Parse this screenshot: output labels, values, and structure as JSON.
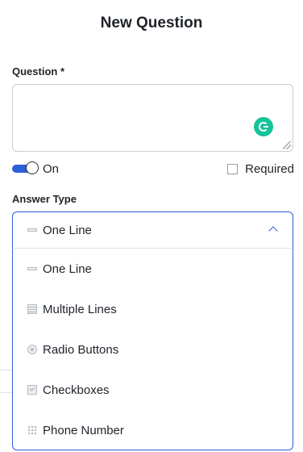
{
  "dialog": {
    "title": "New Question"
  },
  "question": {
    "label": "Question *",
    "value": ""
  },
  "toggle": {
    "label": "On",
    "state": true
  },
  "required": {
    "label": "Required",
    "checked": false
  },
  "answer_type": {
    "label": "Answer Type",
    "selected": "One Line",
    "options": [
      {
        "label": "One Line",
        "icon": "single-line-icon"
      },
      {
        "label": "Multiple Lines",
        "icon": "multiple-lines-icon"
      },
      {
        "label": "Radio Buttons",
        "icon": "radio-button-icon"
      },
      {
        "label": "Checkboxes",
        "icon": "checkbox-icon"
      },
      {
        "label": "Phone Number",
        "icon": "phone-keypad-icon"
      }
    ]
  },
  "colors": {
    "accent": "#2d5fd6",
    "grammarly": "#15c39a"
  }
}
